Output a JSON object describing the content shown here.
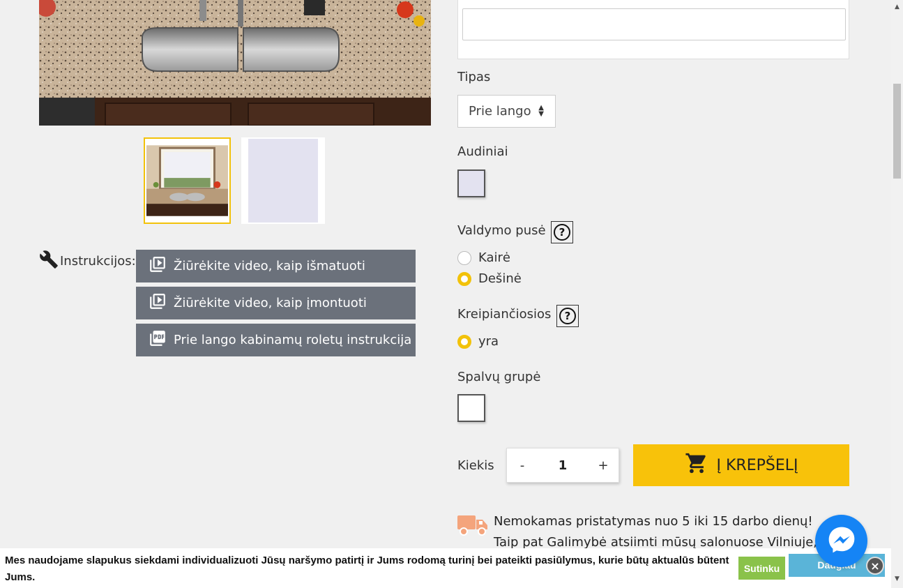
{
  "gallery": {
    "main_image_alt": "kitchen-window-roller-blind",
    "thumbnails": [
      "kitchen-window-thumbnail",
      "fabric-swatch-thumbnail"
    ]
  },
  "instructions": {
    "label": "Instrukcijos:",
    "buttons": [
      {
        "label": "Žiūrėkite video, kaip išmatuoti",
        "icon": "video-icon"
      },
      {
        "label": "Žiūrėkite video, kaip įmontuoti",
        "icon": "video-icon"
      },
      {
        "label": "Prie lango kabinamų roletų instrukcija",
        "icon": "pdf-icon"
      }
    ]
  },
  "options": {
    "tipas": {
      "label": "Tipas",
      "selected": "Prie lango"
    },
    "audiniai": {
      "label": "Audiniai",
      "swatch_color": "#e3e2f0"
    },
    "valdymo_puse": {
      "label": "Valdymo pusė",
      "choices": [
        {
          "label": "Kairė",
          "selected": false
        },
        {
          "label": "Dešinė",
          "selected": true
        }
      ]
    },
    "kreipiancios": {
      "label": "Kreipiančiosios",
      "choices": [
        {
          "label": "yra",
          "selected": true
        }
      ]
    },
    "spalvu_grupe": {
      "label": "Spalvų grupė",
      "swatch_color": "#ffffff"
    }
  },
  "quantity": {
    "label": "Kiekis",
    "minus": "-",
    "value": "1",
    "plus": "+"
  },
  "cart": {
    "label": "Į KREPŠELĮ"
  },
  "delivery": {
    "line1": "Nemokamas pristatymas nuo 5 iki 15 darbo dienų!",
    "line2": "Taip pat Galimybė atsiimti mūsų salonuose Vilniuje,"
  },
  "cookie": {
    "text": "Mes naudojame slapukus siekdami individualizuoti Jūsų naršymo patirtį ir Jums rodomą turinį bei pateikti pasiūlymus, kurie būtų aktualūs būtent Jums.",
    "agree": "Sutinku",
    "more": "Daugiau"
  },
  "colors": {
    "accent": "#f8c20a",
    "button_gray": "#6b717b",
    "messenger": "#1584f5",
    "agree_green": "#8ac24a",
    "more_blue": "#5ab4d8"
  }
}
